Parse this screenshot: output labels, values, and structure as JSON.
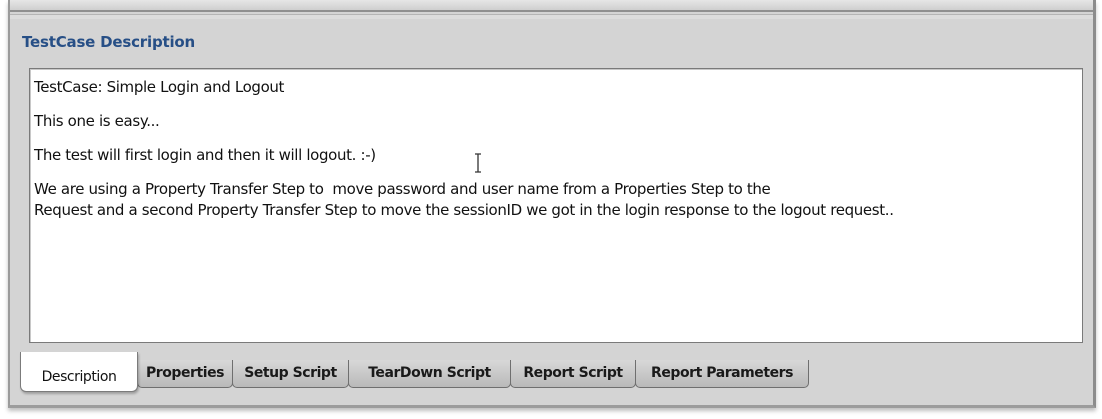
{
  "section": {
    "title": "TestCase Description"
  },
  "description": {
    "lines": [
      "TestCase: Simple Login and Logout",
      "",
      "This one is easy...",
      "",
      "The test will first login and then it will logout. :-)",
      "",
      "We are using a Property Transfer Step to  move password and user name from a Properties Step to the",
      "Request and a second Property Transfer Step to move the sessionID we got in the login response to the logout request.."
    ]
  },
  "tabs": [
    {
      "label": "Description",
      "active": true
    },
    {
      "label": "Properties",
      "active": false
    },
    {
      "label": "Setup Script",
      "active": false
    },
    {
      "label": "TearDown Script",
      "active": false
    },
    {
      "label": "Report Script",
      "active": false
    },
    {
      "label": "Report Parameters",
      "active": false
    }
  ],
  "colors": {
    "title": "#274f86",
    "panel_background": "#d4d4d4",
    "editor_background": "#ffffff"
  },
  "icons": {
    "text_cursor": "i-beam-cursor-icon"
  }
}
